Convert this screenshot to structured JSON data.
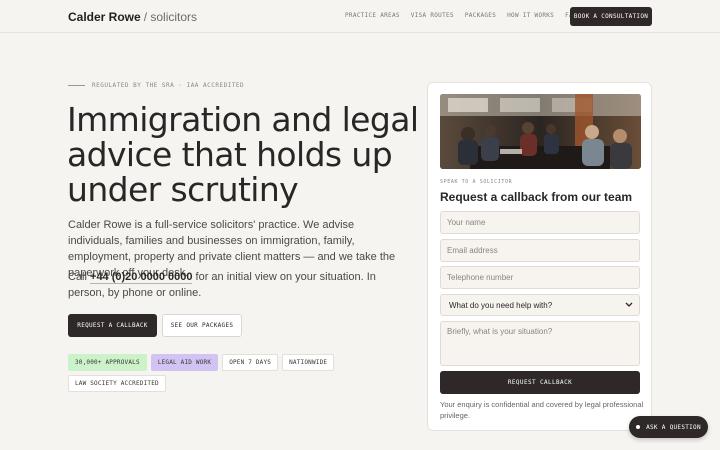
{
  "header": {
    "brand_name": "Calder Rowe",
    "brand_suffix": "/ solicitors",
    "nav": [
      {
        "label": "PRACTICE AREAS"
      },
      {
        "label": "VISA ROUTES"
      },
      {
        "label": "PACKAGES"
      },
      {
        "label": "HOW IT WORKS"
      },
      {
        "label": "FAQ"
      }
    ],
    "cta_label": "BOOK A CONSULTATION"
  },
  "hero": {
    "eyebrow": "REGULATED BY THE SRA · IAA ACCREDITED",
    "headline": "Immigration and legal advice that holds up under scrutiny",
    "intro": "Calder Rowe is a full-service solicitors' practice. We advise individuals, families and businesses on immigration, family, employment, property and private client matters — and we take the paperwork off your desk.",
    "call_prefix": "Call ",
    "phone": "+44 (0)20 0000 0000",
    "call_suffix": " for an initial view on your situation. In person, by phone or online.",
    "primary_cta": "REQUEST A CALLBACK",
    "secondary_cta": "SEE OUR PACKAGES",
    "badges": [
      {
        "label": "30,000+ APPROVALS",
        "style": "green"
      },
      {
        "label": "LEGAL AID WORK",
        "style": "purple"
      },
      {
        "label": "OPEN 7 DAYS",
        "style": "plain"
      },
      {
        "label": "NATIONWIDE",
        "style": "plain"
      },
      {
        "label": "LAW SOCIETY ACCREDITED",
        "style": "plain"
      }
    ]
  },
  "form": {
    "eyebrow": "SPEAK TO A SOLICITOR",
    "title": "Request a callback from our team",
    "name_placeholder": "Your name",
    "email_placeholder": "Email address",
    "phone_placeholder": "Telephone number",
    "select_value": "What do you need help with?",
    "message_placeholder": "Briefly, what is your situation?",
    "submit_label": "REQUEST CALLBACK",
    "note": "Your enquiry is confidential and covered by legal professional privilege."
  },
  "chat": {
    "label": "ASK A QUESTION"
  },
  "colors": {
    "background": "#f6f4f1",
    "dark": "#2e2828",
    "green_badge": "#ccf2c9",
    "purple_badge": "#d3c3f3"
  }
}
